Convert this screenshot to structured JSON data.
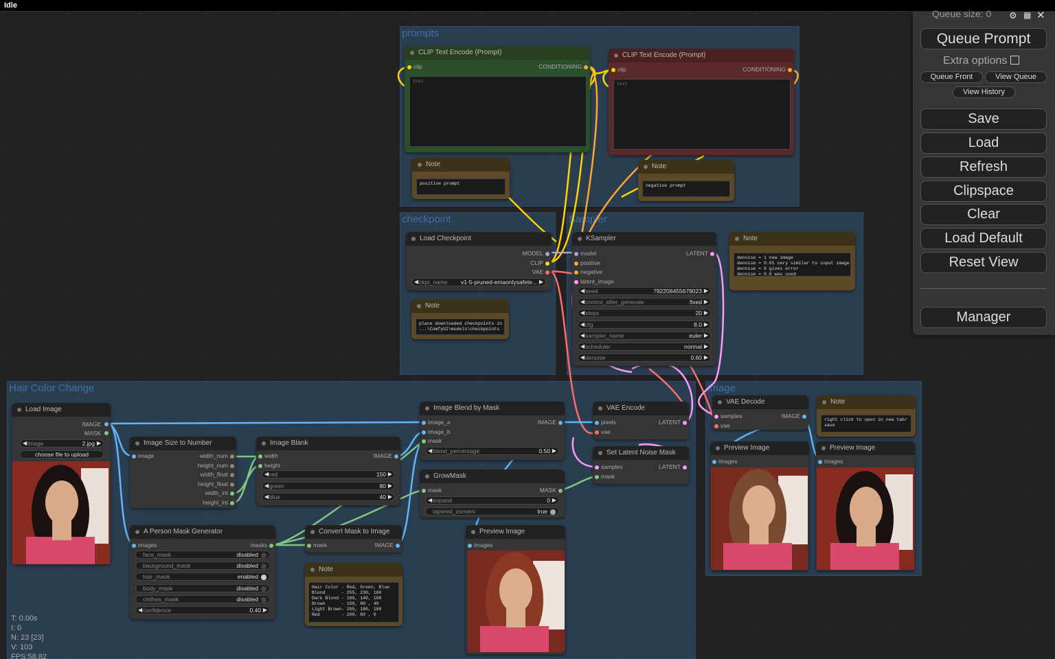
{
  "titlebar": {
    "status": "Idle"
  },
  "groups": {
    "prompts": "prompts",
    "checkpoint": "checkpoint",
    "sampler": "Sampler",
    "hair": "Hair Color Change",
    "image": "image"
  },
  "clip_pos": {
    "title": "CLIP Text Encode (Prompt)",
    "in": "clip",
    "out": "CONDITIONING",
    "placeholder": "text"
  },
  "clip_neg": {
    "title": "CLIP Text Encode (Prompt)",
    "in": "clip",
    "out": "CONDITIONING",
    "placeholder": "text"
  },
  "note_pos": {
    "title": "Note",
    "text": "positive prompt"
  },
  "note_neg": {
    "title": "Note",
    "text": "negative prompt"
  },
  "load_ckpt": {
    "title": "Load Checkpoint",
    "model": "MODEL",
    "clip": "CLIP",
    "vae": "VAE",
    "ckpt_label": "ckpt_name",
    "ckpt_value": "v1-5-pruned-emaonlysafete..."
  },
  "note_ckpt": {
    "title": "Note",
    "text": "place downloaded checkpoints in\n...\\ComfyUI\\models\\checkpoints"
  },
  "ksampler": {
    "title": "KSampler",
    "inputs": [
      "model",
      "positive",
      "negative",
      "latent_image"
    ],
    "out": "LATENT",
    "widgets": [
      {
        "l": "seed",
        "v": "792208455678023"
      },
      {
        "l": "control_after_generate",
        "v": "fixed"
      },
      {
        "l": "steps",
        "v": "20"
      },
      {
        "l": "cfg",
        "v": "8.0"
      },
      {
        "l": "sampler_name",
        "v": "euler"
      },
      {
        "l": "scheduler",
        "v": "normal"
      },
      {
        "l": "denoise",
        "v": "0.60"
      }
    ]
  },
  "note_sampler": {
    "title": "Note",
    "text": "denoise = 1 new image\ndenoise = 0.01 very similar to input image\ndenoise = 0 gives error\ndenoise = 0.6 was used"
  },
  "load_image": {
    "title": "Load Image",
    "out_image": "IMAGE",
    "out_mask": "MASK",
    "image_label": "image",
    "image_value": "2.jpg",
    "upload": "choose file to upload"
  },
  "size_to_num": {
    "title": "Image Size to Number",
    "in": "image",
    "outs": [
      "width_num",
      "height_num",
      "width_float",
      "height_float",
      "width_int",
      "height_int"
    ]
  },
  "image_blank": {
    "title": "Image Blank",
    "ins": [
      "width",
      "height"
    ],
    "out": "IMAGE",
    "widgets": [
      {
        "l": "red",
        "v": "150"
      },
      {
        "l": "green",
        "v": "80"
      },
      {
        "l": "blue",
        "v": "40"
      }
    ]
  },
  "blend": {
    "title": "Image Blend by Mask",
    "ins": [
      "image_a",
      "image_b",
      "mask"
    ],
    "out": "IMAGE",
    "w_label": "blend_percentage",
    "w_value": "0.50"
  },
  "vae_encode": {
    "title": "VAE Encode",
    "ins": [
      "pixels",
      "vae"
    ],
    "out": "LATENT"
  },
  "latent_noise": {
    "title": "Set Latent Noise Mask",
    "ins": [
      "samples",
      "mask"
    ],
    "out": "LATENT"
  },
  "grow": {
    "title": "GrowMask",
    "in": "mask",
    "out": "MASK",
    "expand_label": "expand",
    "expand_value": "0",
    "tap_label": "tapered_corners",
    "tap_value": "true"
  },
  "person_mask": {
    "title": "A Person Mask Generator",
    "in": "images",
    "out": "masks",
    "toggles": [
      {
        "l": "face_mask",
        "v": "disabled"
      },
      {
        "l": "background_mask",
        "v": "disabled"
      },
      {
        "l": "hair_mask",
        "v": "enabled"
      },
      {
        "l": "body_mask",
        "v": "disabled"
      },
      {
        "l": "clothes_mask",
        "v": "disabled"
      }
    ],
    "conf_label": "confidence",
    "conf_value": "0.40"
  },
  "convert": {
    "title": "Convert Mask to Image",
    "in": "mask",
    "out": "IMAGE"
  },
  "preview_mid": {
    "title": "Preview Image",
    "in": "images"
  },
  "note_colors": {
    "title": "Note",
    "text": "Hair Color - Red, Green, Blue\nBlond      - 255, 230, 160\nDark Blond - 180, 140, 100\nBrown      - 150, 80 , 40\nLight Brown- 255, 180, 100\nRed        - 200, 80 , 0"
  },
  "vae_decode": {
    "title": "VAE Decode",
    "ins": [
      "samples",
      "vae"
    ],
    "out": "IMAGE"
  },
  "note_img": {
    "title": "Note",
    "text": "right click to open in new tab/\nsave"
  },
  "preview1": {
    "title": "Preview Image",
    "in": "images"
  },
  "preview2": {
    "title": "Preview Image",
    "in": "images"
  },
  "stats": {
    "t": "T: 0.00s",
    "i": "I: 0",
    "n": "N: 23 [23]",
    "v": "V: 103",
    "fps": "FPS:58.82"
  },
  "panel": {
    "queue_size": "Queue size: 0",
    "queue_prompt": "Queue Prompt",
    "extra": "Extra options",
    "queue_front": "Queue Front",
    "view_queue": "View Queue",
    "view_history": "View History",
    "save": "Save",
    "load": "Load",
    "refresh": "Refresh",
    "clipspace": "Clipspace",
    "clear": "Clear",
    "load_default": "Load Default",
    "reset_view": "Reset View",
    "manager": "Manager"
  },
  "colors": {
    "clip": "#ffd500",
    "model": "#b39ddb",
    "latent": "#ff9cf9",
    "vae": "#ff6e6e",
    "image": "#64b5f6",
    "mask": "#81c784",
    "conditioning": "#ffa931"
  }
}
